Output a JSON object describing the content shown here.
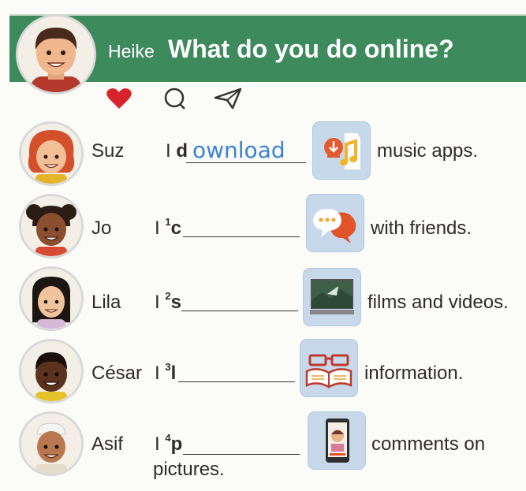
{
  "header": {
    "speaker": "Heike",
    "title": "What do you do online?"
  },
  "icons": [
    "heart-icon",
    "comment-icon",
    "send-icon"
  ],
  "rows": [
    {
      "name": "Suz",
      "prefix": "I",
      "num": "",
      "letter": "d",
      "answer": "ownload",
      "phrase": "music apps.",
      "tile": "music-download-icon"
    },
    {
      "name": "Jo",
      "prefix": "I",
      "num": "1",
      "letter": "c",
      "answer": "",
      "phrase": "with friends.",
      "tile": "chat-bubbles-icon"
    },
    {
      "name": "Lila",
      "prefix": "I",
      "num": "2",
      "letter": "s",
      "answer": "",
      "phrase": "films and videos.",
      "tile": "video-screen-icon"
    },
    {
      "name": "César",
      "prefix": "I",
      "num": "3",
      "letter": "l",
      "answer": "",
      "phrase": "information.",
      "tile": "book-glasses-icon"
    },
    {
      "name": "Asif",
      "prefix": "I",
      "num": "4",
      "letter": "p",
      "answer": "",
      "phrase": "comments on",
      "phrase2": "pictures.",
      "tile": "phone-photo-icon"
    }
  ]
}
